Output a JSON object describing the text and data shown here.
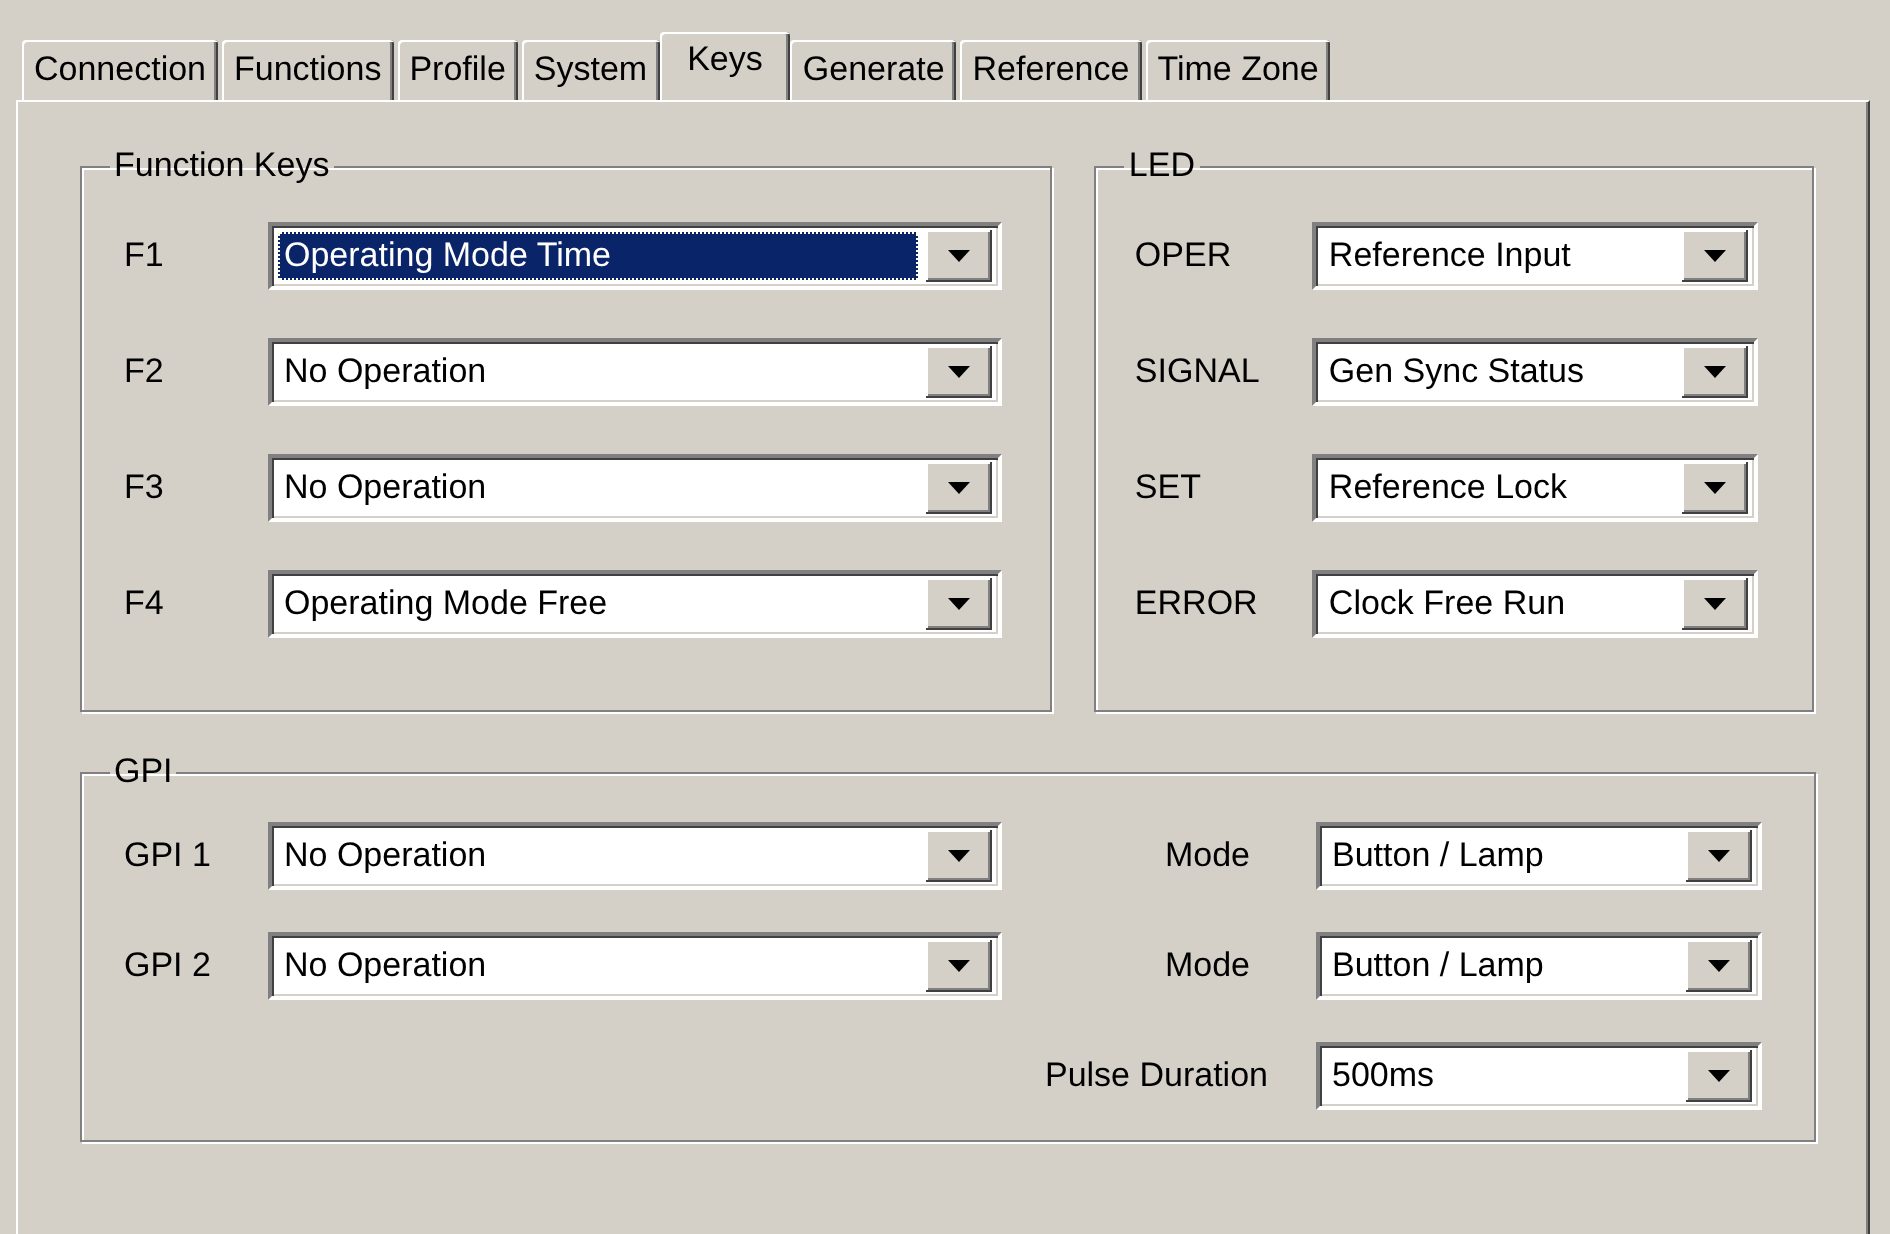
{
  "tabs": [
    {
      "label": "Connection",
      "selected": false
    },
    {
      "label": "Functions",
      "selected": false
    },
    {
      "label": "Profile",
      "selected": false
    },
    {
      "label": "System",
      "selected": false
    },
    {
      "label": "Keys",
      "selected": true
    },
    {
      "label": "Generate",
      "selected": false
    },
    {
      "label": "Reference",
      "selected": false
    },
    {
      "label": "Time Zone",
      "selected": false
    }
  ],
  "function_keys": {
    "title": "Function Keys",
    "rows": [
      {
        "label": "F1",
        "value": "Operating Mode Time",
        "selected": true
      },
      {
        "label": "F2",
        "value": "No Operation",
        "selected": false
      },
      {
        "label": "F3",
        "value": "No Operation",
        "selected": false
      },
      {
        "label": "F4",
        "value": "Operating Mode Free",
        "selected": false
      }
    ]
  },
  "led": {
    "title": "LED",
    "rows": [
      {
        "label": "OPER",
        "value": "Reference Input",
        "selected": false
      },
      {
        "label": "SIGNAL",
        "value": "Gen Sync Status",
        "selected": false
      },
      {
        "label": "SET",
        "value": "Reference Lock",
        "selected": false
      },
      {
        "label": "ERROR",
        "value": "Clock Free Run",
        "selected": false
      }
    ]
  },
  "gpi": {
    "title": "GPI",
    "rows": [
      {
        "label": "GPI 1",
        "value": "No Operation",
        "selected": false,
        "mode_label": "Mode",
        "mode": "Button / Lamp",
        "mode_selected": false
      },
      {
        "label": "GPI 2",
        "value": "No Operation",
        "selected": false,
        "mode_label": "Mode",
        "mode": "Button / Lamp",
        "mode_selected": false
      }
    ],
    "pulse": {
      "label": "Pulse Duration",
      "value": "500ms",
      "selected": false
    }
  }
}
